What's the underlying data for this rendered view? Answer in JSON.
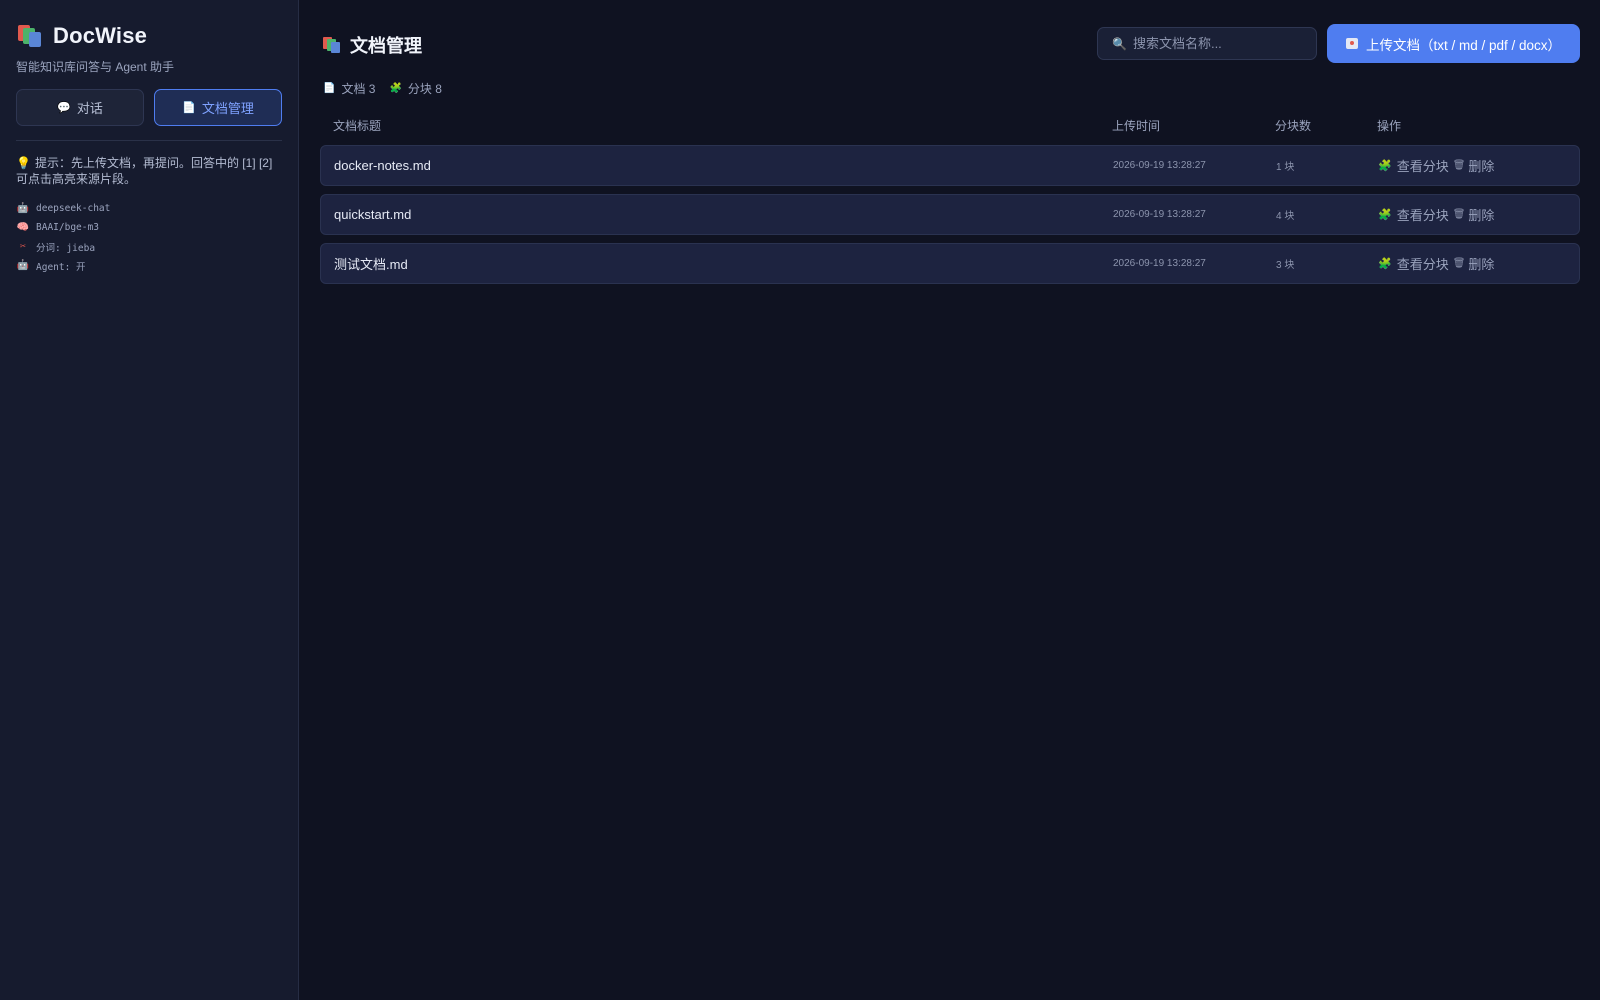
{
  "sidebar": {
    "brand_title": "DocWise",
    "brand_subtitle": "智能知识库问答与 Agent 助手",
    "nav": [
      {
        "label": "对话",
        "icon": "chat-bubble-icon",
        "active": false
      },
      {
        "label": "文档管理",
        "icon": "document-icon",
        "active": true
      }
    ],
    "tip": "提示：先上传文档，再提问。回答中的 [1] [2] 可点击高亮来源片段。",
    "meta": [
      {
        "icon": "robot-icon",
        "text": "deepseek-chat"
      },
      {
        "icon": "brain-icon",
        "text": "BAAI/bge-m3"
      },
      {
        "icon": "scissors-icon",
        "text": "分词: jieba"
      },
      {
        "icon": "robot-icon",
        "text": "Agent: 开"
      }
    ]
  },
  "main": {
    "title": "文档管理",
    "search_placeholder": "搜索文档名称...",
    "upload_label": "上传文档（txt / md / pdf / docx）",
    "stats": {
      "docs_label": "文档 3",
      "chunks_label": "分块 8"
    },
    "table": {
      "headers": [
        "文档标题",
        "上传时间",
        "分块数",
        "操作"
      ],
      "rows": [
        {
          "title": "docker-notes.md",
          "time": "2026-09-19 13:28:27",
          "chunks": "1 块",
          "view": "查看分块",
          "delete": "删除"
        },
        {
          "title": "quickstart.md",
          "time": "2026-09-19 13:28:27",
          "chunks": "4 块",
          "view": "查看分块",
          "delete": "删除"
        },
        {
          "title": "测试文档.md",
          "time": "2026-09-19 13:28:27",
          "chunks": "3 块",
          "view": "查看分块",
          "delete": "删除"
        }
      ]
    }
  },
  "colors": {
    "accent": "#4f7df0",
    "background": "#0f1221",
    "sidebar": "#161b2e",
    "row": "#1d2340"
  }
}
